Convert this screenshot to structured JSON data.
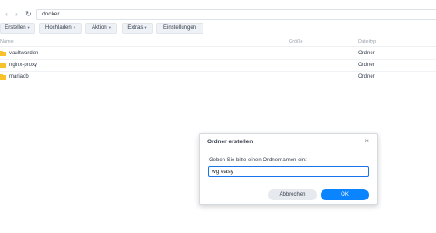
{
  "navigation": {
    "back_icon": "chevron-left-icon",
    "forward_icon": "chevron-right-icon",
    "refresh_icon": "refresh-icon",
    "path": "docker"
  },
  "toolbar": {
    "create_label": "Erstellen",
    "upload_label": "Hochladen",
    "action_label": "Aktion",
    "extras_label": "Extras",
    "settings_label": "Einstellungen"
  },
  "file_list": {
    "columns": {
      "name": "Name",
      "size": "Größe",
      "type": "Dateityp"
    },
    "rows": [
      {
        "name": "vaultwarden",
        "type": "Ordner",
        "icon": "folder-icon"
      },
      {
        "name": "nginx-proxy",
        "type": "Ordner",
        "icon": "folder-icon"
      },
      {
        "name": "mariadb",
        "type": "Ordner",
        "icon": "folder-icon"
      }
    ]
  },
  "dialog": {
    "title": "Ordner erstellen",
    "close_icon": "close-icon",
    "prompt": "Geben Sie bitte einen Ordnernamen ein:",
    "input_value": "wg easy",
    "cancel_label": "Abbrechen",
    "ok_label": "OK"
  },
  "colors": {
    "accent": "#0a84ff",
    "folder": "#f7c12a"
  }
}
